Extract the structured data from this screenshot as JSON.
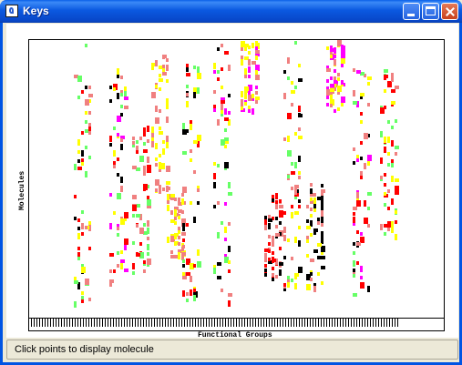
{
  "window": {
    "title": "Keys"
  },
  "plot": {
    "ylabel": "Molecules",
    "xlabel": "Functional Groups"
  },
  "status": {
    "text": "Click points to display molecule"
  },
  "colors": {
    "red": "#ff0000",
    "salmon": "#f08080",
    "yellow": "#ffff00",
    "green": "#66ff66",
    "magenta": "#ff00ff",
    "black": "#000000"
  },
  "chart_data": {
    "type": "heatmap",
    "xlabel": "Functional Groups",
    "ylabel": "Molecules",
    "clusters": [
      {
        "x": 0.13,
        "y": 0.0,
        "h": 0.95,
        "colors": [
          "salmon",
          "yellow",
          "red",
          "green",
          "black"
        ]
      },
      {
        "x": 0.22,
        "y": 0.08,
        "h": 0.83,
        "colors": [
          "salmon",
          "red",
          "yellow",
          "green",
          "magenta",
          "black"
        ]
      },
      {
        "x": 0.28,
        "y": 0.3,
        "h": 0.55,
        "colors": [
          "red",
          "salmon",
          "green"
        ]
      },
      {
        "x": 0.33,
        "y": 0.05,
        "h": 0.5,
        "colors": [
          "yellow",
          "salmon"
        ]
      },
      {
        "x": 0.37,
        "y": 0.55,
        "h": 0.25,
        "colors": [
          "yellow",
          "salmon"
        ]
      },
      {
        "x": 0.41,
        "y": 0.05,
        "h": 0.9,
        "colors": [
          "yellow",
          "salmon",
          "red",
          "black",
          "green"
        ]
      },
      {
        "x": 0.49,
        "y": 0.0,
        "h": 0.95,
        "colors": [
          "salmon",
          "red",
          "yellow",
          "green",
          "black",
          "magenta"
        ]
      },
      {
        "x": 0.56,
        "y": 0.0,
        "h": 0.25,
        "colors": [
          "magenta",
          "salmon",
          "yellow"
        ]
      },
      {
        "x": 0.62,
        "y": 0.55,
        "h": 0.3,
        "colors": [
          "black",
          "salmon",
          "red"
        ]
      },
      {
        "x": 0.67,
        "y": 0.0,
        "h": 0.9,
        "colors": [
          "salmon",
          "red",
          "yellow",
          "green",
          "black"
        ]
      },
      {
        "x": 0.73,
        "y": 0.5,
        "h": 0.4,
        "colors": [
          "black",
          "yellow",
          "salmon"
        ]
      },
      {
        "x": 0.78,
        "y": 0.0,
        "h": 0.25,
        "colors": [
          "salmon",
          "yellow",
          "magenta"
        ]
      },
      {
        "x": 0.85,
        "y": 0.1,
        "h": 0.85,
        "colors": [
          "red",
          "salmon",
          "green",
          "yellow",
          "black",
          "magenta"
        ]
      },
      {
        "x": 0.92,
        "y": 0.1,
        "h": 0.6,
        "colors": [
          "red",
          "salmon",
          "green",
          "yellow"
        ]
      }
    ]
  }
}
